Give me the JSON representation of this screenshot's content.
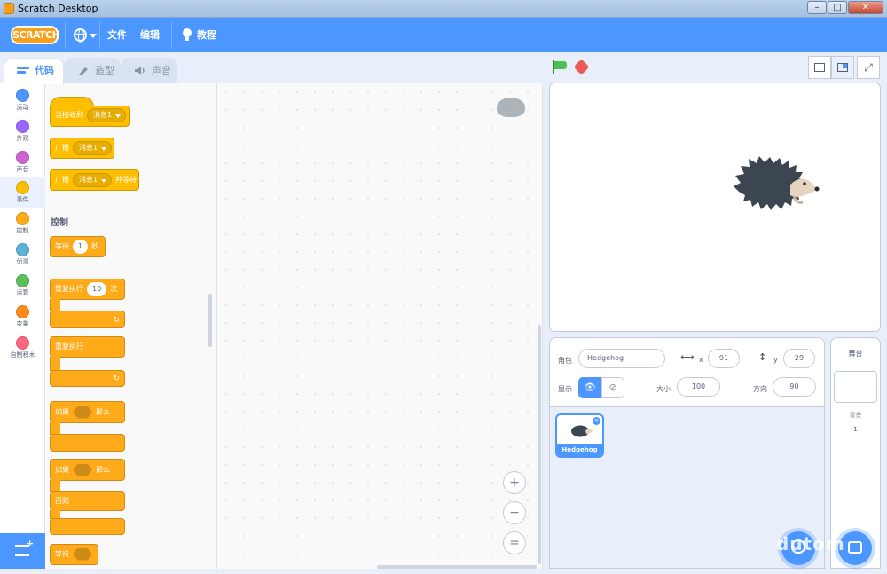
{
  "window": {
    "title": "Scratch Desktop",
    "minimize": "–",
    "maximize": "□",
    "close": "✕"
  },
  "menubar": {
    "logo_text": "SCRATCH",
    "file": "文件",
    "edit": "编辑",
    "tutorials": "教程"
  },
  "tabs": [
    {
      "label": "代码",
      "active": true
    },
    {
      "label": "造型",
      "active": false
    },
    {
      "label": "声音",
      "active": false
    }
  ],
  "categories": [
    {
      "label": "运动",
      "color": "#4c97ff"
    },
    {
      "label": "外观",
      "color": "#9966ff"
    },
    {
      "label": "声音",
      "color": "#cf63cf"
    },
    {
      "label": "事件",
      "color": "#ffbf00"
    },
    {
      "label": "控制",
      "color": "#ffab19"
    },
    {
      "label": "侦测",
      "color": "#5cb1d6"
    },
    {
      "label": "运算",
      "color": "#59c059"
    },
    {
      "label": "变量",
      "color": "#ff8c1a"
    },
    {
      "label": "自制积木",
      "color": "#ff6680"
    }
  ],
  "selected_category": "事件",
  "palette": {
    "events_blocks": [
      {
        "text": "当接收到",
        "dropdown": "消息1"
      },
      {
        "text": "广播",
        "dropdown": "消息1"
      },
      {
        "text": "广播",
        "dropdown": "消息1",
        "suffix": "并等待"
      }
    ],
    "control_title": "控制",
    "wait": {
      "text": "等待",
      "value": "1",
      "suffix": "秒"
    },
    "repeat": {
      "text": "重复执行",
      "value": "10",
      "suffix": "次",
      "arrow": "↻"
    },
    "forever": {
      "text": "重复执行",
      "arrow": "↻"
    },
    "if_then": {
      "text": "如果",
      "suffix": "那么"
    },
    "if_else": {
      "text": "如果",
      "suffix": "那么",
      "else": "否则"
    },
    "wait_until": {
      "text": "等待"
    }
  },
  "zoom": {
    "in": "+",
    "out": "−",
    "reset": "="
  },
  "stage_modes": {
    "fullscreen": "⤢"
  },
  "sprite_info": {
    "sprite_label": "角色",
    "sprite_name": "Hedgehog",
    "x_label": "x",
    "x_value": "91",
    "y_label": "y",
    "y_value": "29",
    "show_label": "显示",
    "size_label": "大小",
    "size_value": "100",
    "direction_label": "方向",
    "direction_value": "90",
    "x_arrow": "⟷",
    "y_arrow": "↕",
    "show_on": "👁",
    "show_off": "⊘"
  },
  "sprites": [
    {
      "name": "Hedgehog",
      "delete": "×"
    }
  ],
  "stage_pane": {
    "title": "舞台",
    "backdrops_label": "背景",
    "backdrops_count": "1"
  },
  "watermark": "dutom",
  "colors": {
    "accent": "#4c97ff",
    "events": "#ffbf00",
    "control": "#ffab19"
  }
}
